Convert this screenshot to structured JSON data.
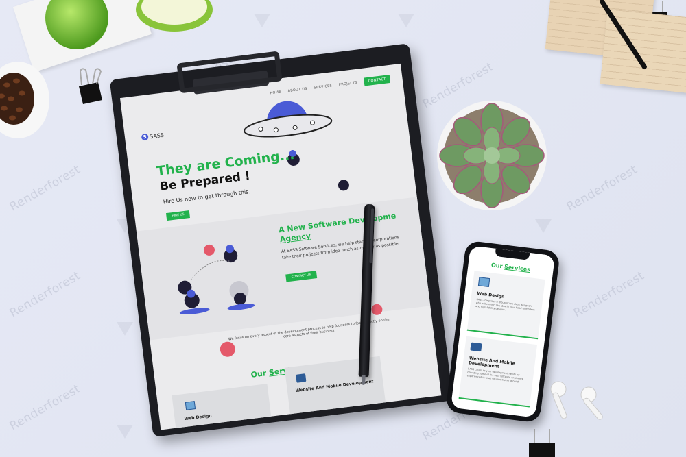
{
  "watermark": {
    "text": "Renderforest"
  },
  "mockup": {
    "nav": {
      "items": [
        "HOME",
        "ABOUT US",
        "SERVICES",
        "PROJECTS"
      ],
      "contact": "CONTACT"
    },
    "logo": "SASS",
    "hero": {
      "title": "They are Coming...",
      "subtitle": "Be Prepared !",
      "description": "Hire Us now to get through this.",
      "button": "HIRE US"
    },
    "agency": {
      "title_line1": "A New Software Developme",
      "title_line2": "Agency",
      "description": "At SASS Software Services, we help startups corporations take their projects from idea lunch as quickly as possible.",
      "button": "CONTACT US"
    },
    "process": {
      "description": "We focus on every aspect of the development process to help founders to focus strictly on the core aspects of their business."
    },
    "services": {
      "title_prefix": "Our",
      "title_highlight": "Services",
      "cards": [
        {
          "title": "Web Design"
        },
        {
          "title": "Website And Mobile Development"
        }
      ]
    }
  },
  "phone": {
    "title_prefix": "Our",
    "title_highlight": "Services",
    "cards": [
      {
        "title": "Web Design",
        "description": "SASS comprises a group of top class designers who will convert the idea in your head to modern and high fidelity designs."
      },
      {
        "title": "Website And Mobile Development",
        "description": "SASS caters to your development needs by providing some of the best software engineers experienced in what you are trying to build."
      }
    ]
  },
  "colors": {
    "accent": "#22b24c",
    "purple": "#4a5bd6",
    "background": "#e3e7f3"
  }
}
